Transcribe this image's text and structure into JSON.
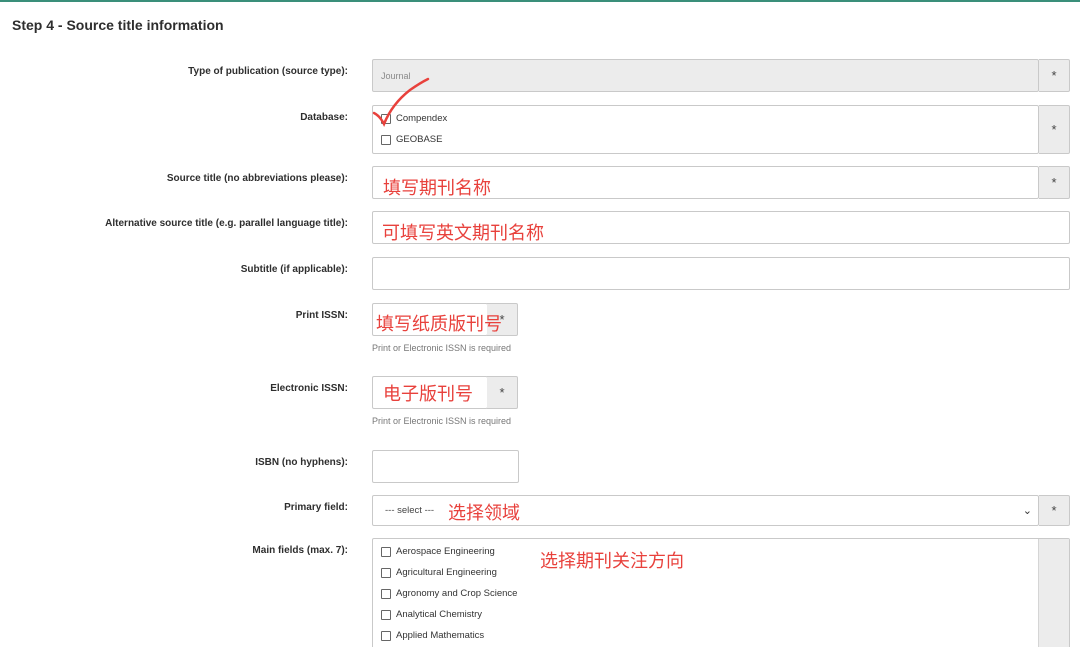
{
  "step": {
    "title": "Step 4 - Source title information"
  },
  "fields": {
    "type_of_publication": {
      "label": "Type of publication (source type):",
      "value": "Journal"
    },
    "database": {
      "label": "Database:",
      "options": [
        "Compendex",
        "GEOBASE"
      ]
    },
    "source_title": {
      "label": "Source title (no abbreviations please):",
      "value": ""
    },
    "alternative_source_title": {
      "label": "Alternative source title (e.g. parallel language title):",
      "value": ""
    },
    "subtitle": {
      "label": "Subtitle (if applicable):",
      "value": ""
    },
    "print_issn": {
      "label": "Print ISSN:",
      "value": "",
      "help": "Print or Electronic ISSN is required"
    },
    "electronic_issn": {
      "label": "Electronic ISSN:",
      "value": "",
      "help": "Print or Electronic ISSN is required"
    },
    "isbn": {
      "label": "ISBN (no hyphens):",
      "value": ""
    },
    "primary_field": {
      "label": "Primary field:",
      "selected": "--- select ---"
    },
    "main_fields": {
      "label": "Main fields (max. 7):",
      "options": [
        "Aerospace Engineering",
        "Agricultural Engineering",
        "Agronomy and Crop Science",
        "Analytical Chemistry",
        "Applied Mathematics"
      ]
    }
  },
  "required_marker": "*",
  "annotations": {
    "source_title": "填写期刊名称",
    "alternative_source_title": "可填写英文期刊名称",
    "print_issn": "填写纸质版刊号",
    "electronic_issn": "电子版刊号",
    "primary_field": "选择领域",
    "main_fields": "选择期刊关注方向"
  },
  "colors": {
    "annotation": "#e8413c",
    "required_bg": "#ececec",
    "border": "#c9c9c9",
    "accent_line": "#3a8f7a"
  },
  "icons": {
    "required": "asterisk-icon",
    "dropdown": "chevron-down-icon",
    "check_mark": "red-checkmark-annotation"
  }
}
